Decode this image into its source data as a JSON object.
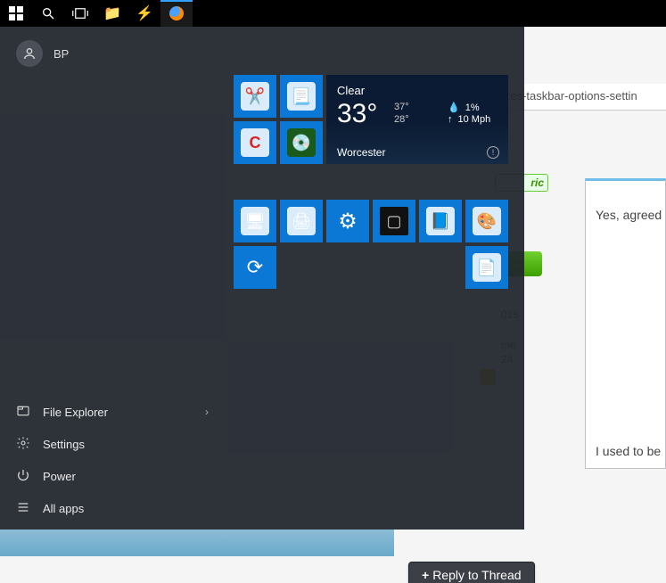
{
  "taskbar": {
    "items": [
      {
        "name": "start-button"
      },
      {
        "name": "search-button"
      },
      {
        "name": "task-view-button"
      },
      {
        "name": "file-explorer-taskbar"
      },
      {
        "name": "winamp-taskbar"
      },
      {
        "name": "firefox-taskbar"
      }
    ]
  },
  "start_menu": {
    "user": "BP",
    "bottom": [
      {
        "label": "File Explorer",
        "has_sub": true,
        "icon": "file-explorer-icon"
      },
      {
        "label": "Settings",
        "has_sub": false,
        "icon": "settings-gear-icon"
      },
      {
        "label": "Power",
        "has_sub": false,
        "icon": "power-icon"
      },
      {
        "label": "All apps",
        "has_sub": false,
        "icon": "all-apps-icon"
      }
    ],
    "tiles_group1": [
      {
        "name": "snipping-tool-tile",
        "glyph": "✂️"
      },
      {
        "name": "scanner-tile",
        "glyph": "📃"
      },
      {
        "name": "ccleaner-tile",
        "glyph": "C"
      },
      {
        "name": "disc-app-tile",
        "glyph": "💿"
      }
    ],
    "tiles_group2": [
      {
        "name": "control-panel-tile",
        "glyph": "🖥"
      },
      {
        "name": "printers-tile",
        "glyph": "🖨"
      },
      {
        "name": "services-tile",
        "glyph": "⚙"
      },
      {
        "name": "cmd-tile",
        "glyph": "▢"
      },
      {
        "name": "notepad-tile",
        "glyph": "📘"
      },
      {
        "name": "paint-tile",
        "glyph": "🎨"
      },
      {
        "name": "restart-tile",
        "glyph": "⟳"
      },
      {
        "name": "run-tile",
        "glyph": "📄"
      }
    ],
    "weather": {
      "condition": "Clear",
      "temp": "33°",
      "high": "37°",
      "low": "28°",
      "precip": "1%",
      "wind": "10 Mph",
      "city": "Worcester"
    }
  },
  "background": {
    "address_fragment": "res-taskbar-options-settin",
    "badge": "ric",
    "meta": {
      "date": "015",
      "label2": "me",
      "count": "24"
    },
    "comment1": "Yes, agreed",
    "comment2": "I used to be",
    "reply_button": "Reply to Thread",
    "reply_plus": "+"
  }
}
